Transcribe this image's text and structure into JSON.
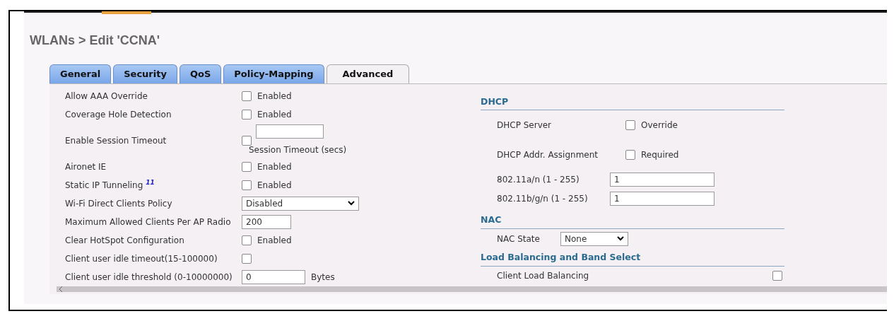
{
  "title": "WLANs > Edit  'CCNA'",
  "tabs": [
    {
      "label": "General",
      "selected": false
    },
    {
      "label": "Security",
      "selected": false
    },
    {
      "label": "QoS",
      "selected": false
    },
    {
      "label": "Policy-Mapping",
      "selected": false
    },
    {
      "label": "Advanced",
      "selected": true
    }
  ],
  "left_settings": [
    {
      "kind": "checkbox",
      "label": "Allow AAA Override",
      "checked": false,
      "option": "Enabled"
    },
    {
      "kind": "checkbox",
      "label": "Coverage Hole Detection",
      "checked": false,
      "option": "Enabled"
    },
    {
      "kind": "timeout",
      "label": "Enable Session Timeout",
      "checked": false,
      "caption": "Session Timeout (secs)"
    },
    {
      "kind": "checkbox",
      "label": "Aironet IE",
      "checked": false,
      "option": "Enabled"
    },
    {
      "kind": "checkbox",
      "label": "Static IP Tunneling",
      "sup": "11",
      "checked": false,
      "option": "Enabled"
    },
    {
      "kind": "select",
      "label": "Wi-Fi Direct Clients Policy",
      "value": "Disabled"
    },
    {
      "kind": "text",
      "label": "Maximum Allowed Clients Per AP Radio",
      "value": "200"
    },
    {
      "kind": "checkbox",
      "label": "Clear HotSpot Configuration",
      "checked": false,
      "option": "Enabled"
    },
    {
      "kind": "checkbox",
      "label": "Client user idle timeout(15-100000)",
      "checked": false
    },
    {
      "kind": "text",
      "label": "Client user idle threshold (0-10000000)",
      "value": "0",
      "suffix": "Bytes"
    }
  ],
  "right_sections": [
    {
      "heading": "DHCP",
      "rows": [
        {
          "kind": "checkbox",
          "label": "DHCP Server",
          "checked": false,
          "option": "Override"
        },
        {
          "kind": "checkbox",
          "label": "DHCP Addr. Assignment",
          "checked": false,
          "option": "Required"
        }
      ]
    },
    {
      "rows": [
        {
          "kind": "wide-text",
          "label": "802.11a/n (1 - 255)",
          "value": "1"
        },
        {
          "kind": "wide-text",
          "label": "802.11b/g/n (1 - 255)",
          "value": "1"
        }
      ]
    },
    {
      "heading": "NAC",
      "rows": [
        {
          "kind": "select",
          "label": "NAC State",
          "value": "None"
        }
      ]
    },
    {
      "heading": "Load Balancing and Band Select",
      "rows": [
        {
          "kind": "far-checkbox",
          "label": "Client Load Balancing",
          "checked": false
        }
      ]
    }
  ]
}
